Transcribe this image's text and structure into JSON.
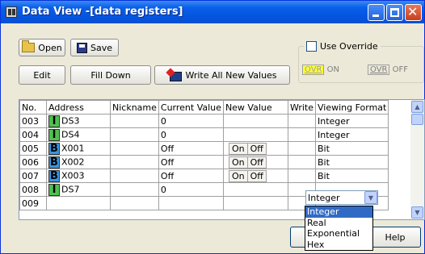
{
  "window": {
    "title": "Data View -[data registers]"
  },
  "toolbar": {
    "open_label": "Open",
    "save_label": "Save",
    "edit_label": "Edit",
    "fill_down_label": "Fill Down",
    "write_all_label": "Write All New Values"
  },
  "override": {
    "label": "Use Override",
    "ovr_on_box": "OVR",
    "on_label": "ON",
    "ovr_off_box": "OVR",
    "off_label": "OFF"
  },
  "grid": {
    "headers": [
      "No.",
      "Address",
      "Nickname",
      "Current Value",
      "New Value",
      "Write",
      "Viewing Format"
    ],
    "rows": [
      {
        "no": "003",
        "type": "I",
        "address": "DS3",
        "nickname": "",
        "current": "0",
        "new_on": "",
        "new_off": "",
        "write": "",
        "format": "Integer"
      },
      {
        "no": "004",
        "type": "I",
        "address": "DS4",
        "nickname": "",
        "current": "0",
        "new_on": "",
        "new_off": "",
        "write": "",
        "format": "Integer"
      },
      {
        "no": "005",
        "type": "B",
        "address": "X001",
        "nickname": "",
        "current": "Off",
        "new_on": "On",
        "new_off": "Off",
        "write": "",
        "format": "Bit"
      },
      {
        "no": "006",
        "type": "B",
        "address": "X002",
        "nickname": "",
        "current": "Off",
        "new_on": "On",
        "new_off": "Off",
        "write": "",
        "format": "Bit"
      },
      {
        "no": "007",
        "type": "B",
        "address": "X003",
        "nickname": "",
        "current": "Off",
        "new_on": "On",
        "new_off": "Off",
        "write": "",
        "format": "Bit"
      },
      {
        "no": "008",
        "type": "I",
        "address": "DS7",
        "nickname": "",
        "current": "0",
        "new_on": "",
        "new_off": "",
        "write": "",
        "format": ""
      },
      {
        "no": "009",
        "type": "",
        "address": "",
        "nickname": "",
        "current": "",
        "new_on": "",
        "new_off": "",
        "write": "",
        "format": ""
      }
    ]
  },
  "format_combo": {
    "selected": "Integer",
    "options": [
      "Integer",
      "Real",
      "Exponential",
      "Hex"
    ]
  },
  "footer": {
    "help_label": "Help"
  }
}
